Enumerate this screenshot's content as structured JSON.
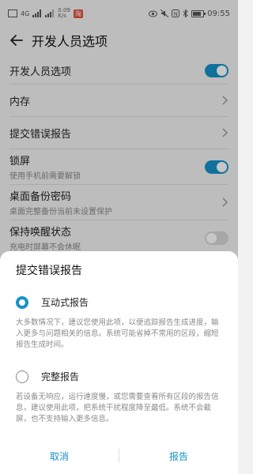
{
  "colors": {
    "accent": "#1592c8",
    "toggle_off": "#d6d6d6",
    "status_badge": "#e0523f"
  },
  "status_bar": {
    "signal_label": "4G",
    "net_speed_top": "0.09",
    "net_speed_bottom": "K/s",
    "time": "09:55",
    "battery_level": 0.85
  },
  "header": {
    "back_icon": "back-arrow-icon",
    "title": "开发人员选项"
  },
  "settings": [
    {
      "title": "开发人员选项",
      "subtitle": "",
      "control": "toggle",
      "on": true
    },
    {
      "title": "内存",
      "subtitle": "",
      "control": "chevron"
    },
    {
      "title": "提交错误报告",
      "subtitle": "",
      "control": "chevron"
    },
    {
      "title": "锁屏",
      "subtitle": "使用手机前需要解锁",
      "control": "toggle",
      "on": true
    },
    {
      "title": "桌面备份密码",
      "subtitle": "桌面完整备份当前未设置保护",
      "control": "chevron"
    },
    {
      "title": "保持唤醒状态",
      "subtitle": "充电时屏幕不会休眠",
      "control": "toggle",
      "on": false
    }
  ],
  "dialog": {
    "title": "提交错误报告",
    "options": [
      {
        "label": "互动式报告",
        "selected": true,
        "description": "大多数情况下，建议您使用此项，以便追踪报告生成进度，输入更多与问题相关的信息。系统可能省掉不常用的区段，缩短报告生成时间。"
      },
      {
        "label": "完整报告",
        "selected": false,
        "description": "若设备无响应，运行速度慢，或您需要查看所有区段的报告信息，建议使用此项，把系统干扰程度降至最低。系统不会截屏，也不支持输入更多信息。"
      }
    ],
    "cancel_label": "取消",
    "confirm_label": "报告"
  }
}
